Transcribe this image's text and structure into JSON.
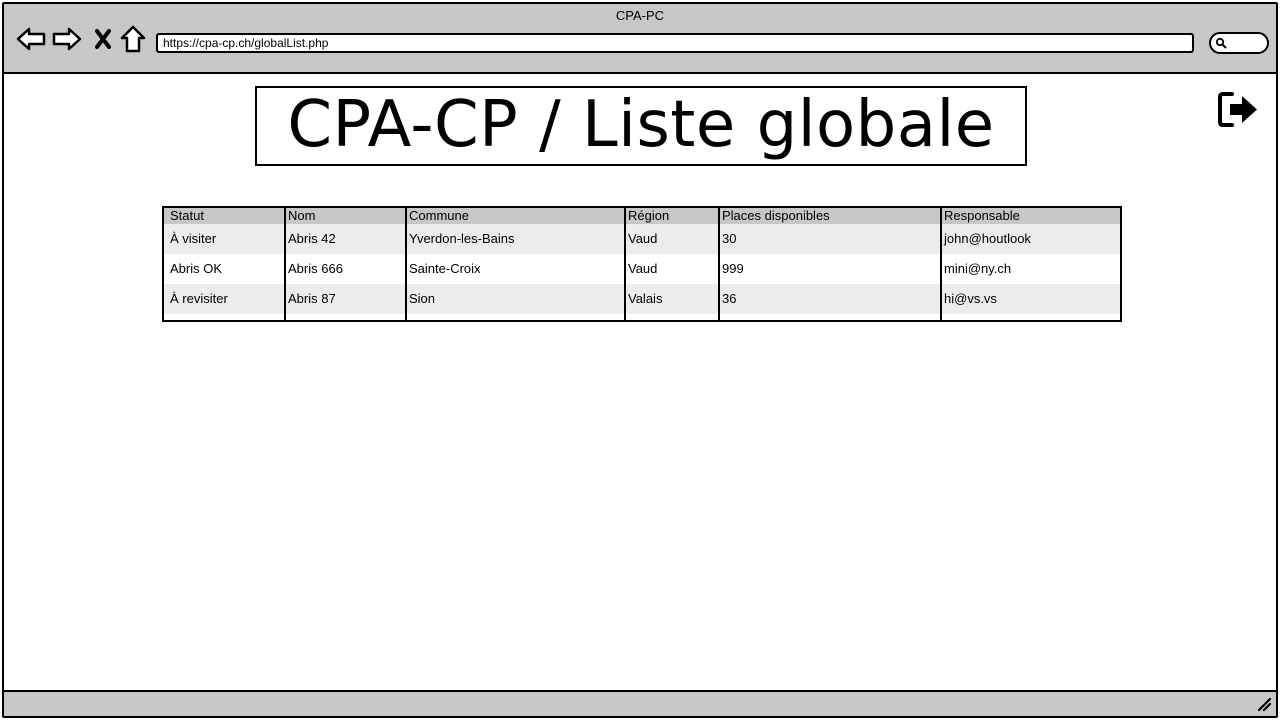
{
  "window": {
    "title": "CPA-PC"
  },
  "toolbar": {
    "back_icon": "arrow-left-icon",
    "forward_icon": "arrow-right-icon",
    "stop_icon": "close-icon",
    "home_icon": "home-icon",
    "url": "https://cpa-cp.ch/globalList.php",
    "search_icon": "search-icon"
  },
  "page": {
    "title": "CPA-CP / Liste globale",
    "logout_icon": "logout-icon"
  },
  "table": {
    "columns": [
      "Statut",
      "Nom",
      "Commune",
      "Région",
      "Places disponibles",
      "Responsable"
    ],
    "rows": [
      [
        "À visiter",
        "Abris 42",
        "Yverdon-les-Bains",
        "Vaud",
        "30",
        "john@houtlook"
      ],
      [
        "Abris OK",
        "Abris 666",
        "Sainte-Croix",
        "Vaud",
        "999",
        "mini@ny.ch"
      ],
      [
        "À revisiter",
        "Abris 87",
        "Sion",
        "Valais",
        "36",
        "hi@vs.vs"
      ]
    ]
  },
  "colors": {
    "chrome": "#c7c7c7",
    "row_alt": "#ececec",
    "border": "#000000"
  }
}
